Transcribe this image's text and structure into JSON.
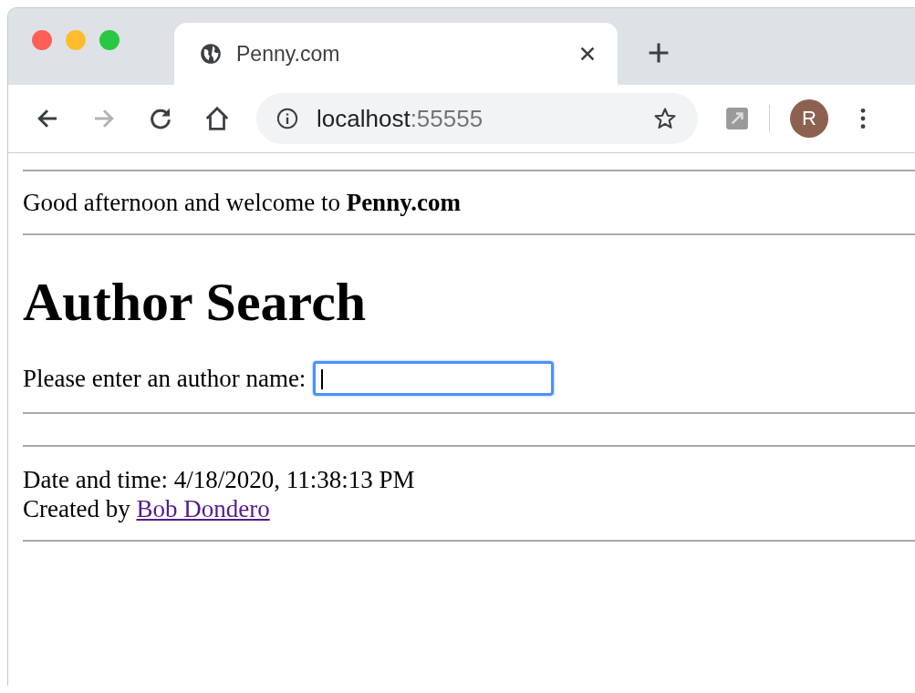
{
  "browser": {
    "tab": {
      "title": "Penny.com",
      "selected": true
    },
    "address": {
      "host": "localhost",
      "port": ":55555"
    },
    "profile_initial": "R"
  },
  "page": {
    "welcome": "Good afternoon and welcome to **Penny.com**",
    "heading": "Author Search",
    "search": {
      "label": "Please enter an author name:",
      "focused": true
    },
    "footer": {
      "datetime": "Date and time: 4/18/2020, 11:38:13 PM",
      "created_prefix": "Created by",
      "author_link": "Bob Dondero"
    }
  }
}
